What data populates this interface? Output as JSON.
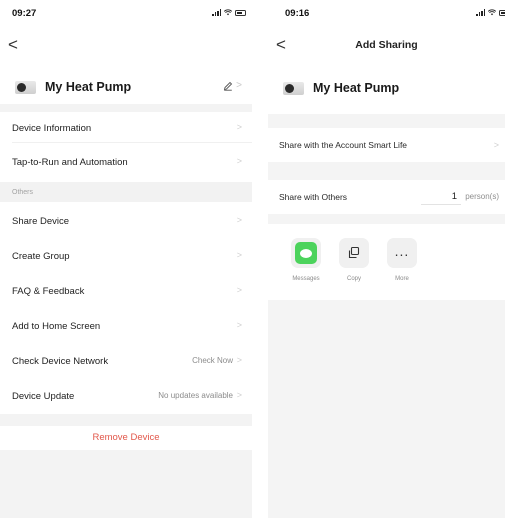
{
  "left": {
    "status": {
      "time": "09:27"
    },
    "back_glyph": "<",
    "device": {
      "name": "My Heat Pump",
      "edit_icon": "pencil-icon"
    },
    "rows_top": [
      {
        "label": "Device Information"
      },
      {
        "label": "Tap-to-Run and Automation"
      }
    ],
    "section_label": "Others",
    "rows_others": [
      {
        "label": "Share Device",
        "value": ""
      },
      {
        "label": "Create Group",
        "value": ""
      },
      {
        "label": "FAQ & Feedback",
        "value": ""
      },
      {
        "label": "Add to Home Screen",
        "value": ""
      },
      {
        "label": "Check Device Network",
        "value": "Check Now"
      },
      {
        "label": "Device Update",
        "value": "No updates available"
      }
    ],
    "remove_label": "Remove Device"
  },
  "right": {
    "status": {
      "time": "09:16"
    },
    "back_glyph": "<",
    "title": "Add Sharing",
    "device": {
      "name": "My Heat Pump"
    },
    "share_account_label": "Share with the Account Smart Life",
    "share_others_label": "Share with Others",
    "share_count": "1",
    "share_unit": "person(s)",
    "targets": [
      {
        "label": "Messages",
        "icon": "messages-icon"
      },
      {
        "label": "Copy",
        "icon": "copy-icon"
      },
      {
        "label": "More",
        "icon": "more-icon"
      }
    ]
  },
  "colors": {
    "accent_remove": "#e2584b",
    "messages_green": "#4cd35c",
    "background_gray": "#f3f3f3"
  }
}
